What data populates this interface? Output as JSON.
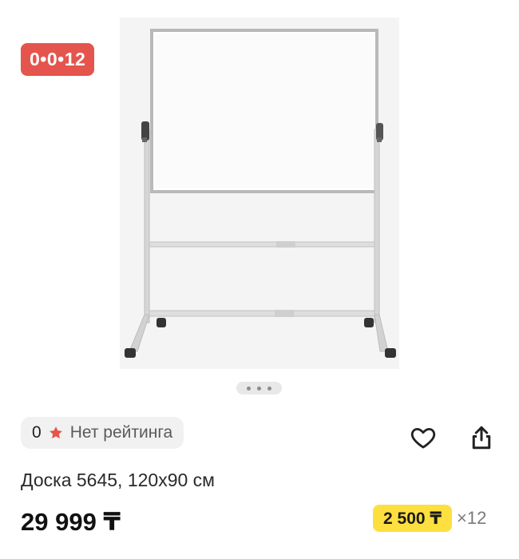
{
  "product": {
    "timer_badge": "0•0•12",
    "gallery": {
      "total_images": 3,
      "active_index": 0
    },
    "rating": {
      "count": "0",
      "label": "Нет рейтинга",
      "star_color": "#e4554d"
    },
    "actions": {
      "favorite_icon": "heart-outline-icon",
      "share_icon": "share-icon"
    },
    "title": "Доска 5645, 120x90 см",
    "price": "29 999 ₸",
    "installment": {
      "amount": "2 500 ₸",
      "months": "×12",
      "badge_color": "#fddf3f"
    }
  }
}
